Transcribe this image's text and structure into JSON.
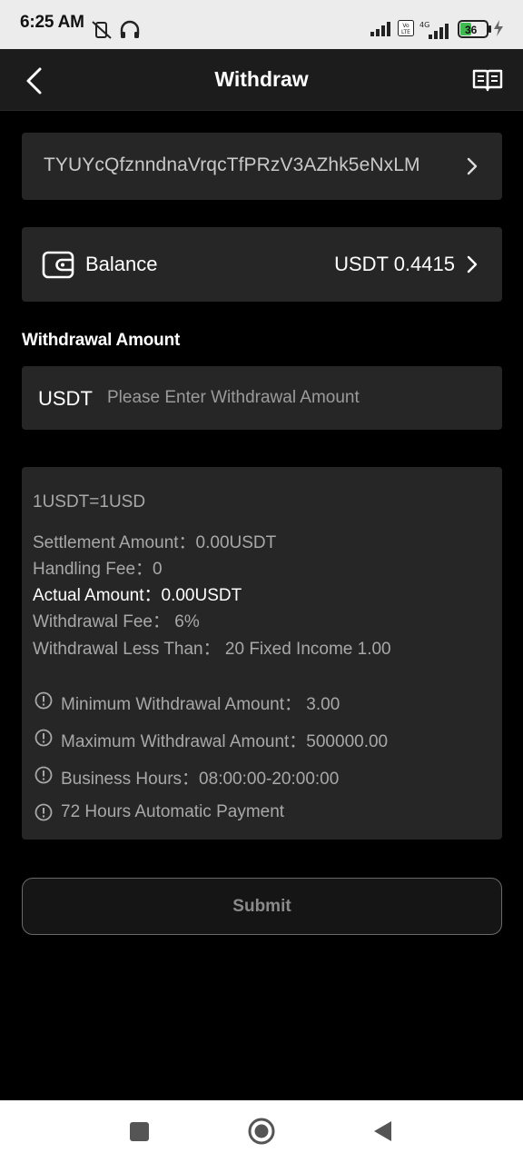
{
  "status_bar": {
    "time": "6:25 AM",
    "battery": "36"
  },
  "header": {
    "title": "Withdraw"
  },
  "address": {
    "value": "TYUYcQfznndnaVrqcTfPRzV3AZhk5eNxLM"
  },
  "balance": {
    "label": "Balance",
    "value": "USDT 0.4415"
  },
  "withdrawal": {
    "section_title": "Withdrawal Amount",
    "currency": "USDT",
    "placeholder": "Please Enter Withdrawal Amount",
    "value": ""
  },
  "info": {
    "rate": "1USDT=1USD",
    "settlement": "Settlement Amount：0.00USDT",
    "handling_fee": "Handling Fee：0",
    "actual_amount": "Actual Amount：0.00USDT",
    "withdrawal_fee": "Withdrawal Fee： 6%",
    "less_than": "Withdrawal Less Than： 20 Fixed Income 1.00",
    "notices": [
      "Minimum Withdrawal Amount： 3.00",
      "Maximum Withdrawal Amount：500000.00",
      "Business Hours：08:00:00-20:00:00",
      "72 Hours Automatic Payment"
    ]
  },
  "submit": {
    "label": "Submit"
  },
  "colors": {
    "background": "#000000",
    "card": "#262626",
    "header": "#1c1c1c",
    "muted_text": "#a8a8a8"
  },
  "icons": {
    "back": "chevron-left-icon",
    "record": "book-icon",
    "wallet": "wallet-icon",
    "notice": "info-circle-icon"
  }
}
